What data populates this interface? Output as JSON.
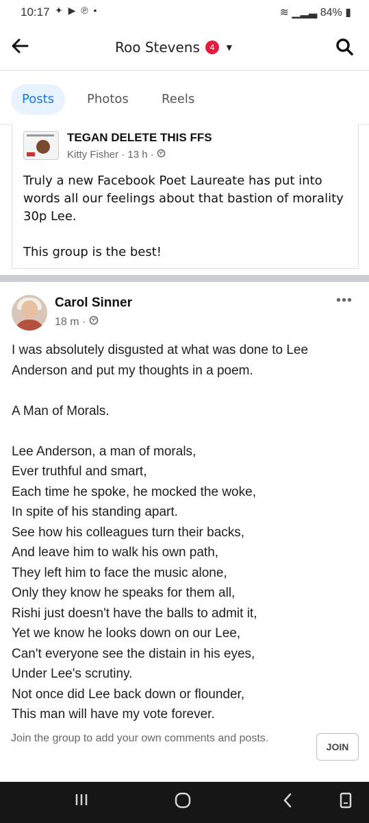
{
  "status_bar": {
    "time": "10:17",
    "left_icons": [
      "notification-icon",
      "youtube-icon",
      "pinterest-icon",
      "dot-icon"
    ],
    "battery": "84%"
  },
  "header": {
    "title": "Roo Stevens",
    "notification_count": "4",
    "icons": [
      "back-arrow-icon",
      "caret-down-icon",
      "search-icon"
    ]
  },
  "tabs": [
    {
      "label": "Posts",
      "active": true
    },
    {
      "label": "Photos",
      "active": false
    },
    {
      "label": "Reels",
      "active": false
    }
  ],
  "shared_post": {
    "group": "TEGAN DELETE THIS FFS",
    "author": "Kitty Fisher",
    "time": "13 h",
    "visibility_icon": "globe-icon",
    "paragraphs": [
      "Truly a new Facebook Poet Laureate has put into words all our feelings about that bastion of morality 30p Lee.",
      "This group is the best!"
    ]
  },
  "post": {
    "author": "Carol Sinner",
    "time": "18 m",
    "visibility_icon": "globe-icon",
    "intro": "I was absolutely disgusted at what was done to Lee Anderson and put my thoughts in a poem.",
    "poem_title": "A Man of Morals.",
    "poem_lines": [
      "Lee Anderson, a man of morals,",
      "Ever truthful and smart,",
      "Each time he spoke, he mocked the woke,",
      "In spite of his standing apart.",
      "See how his colleagues turn their backs,",
      "And leave him to walk his own path,",
      "They left him to face the music alone,",
      "Only they know he speaks for them all,",
      "Rishi just doesn't have the balls to admit it,",
      "Yet we know he looks down on our Lee,",
      "Can't everyone see the distain in his eyes,",
      "Under Lee's scrutiny.",
      "Not once did Lee back down or flounder,",
      "This man will have my vote forever."
    ]
  },
  "join_bar": {
    "text": "Join the group to add your own comments and posts.",
    "button": "JOIN"
  },
  "android_nav": [
    "recents-icon",
    "home-icon",
    "back-icon",
    "screenshot-icon"
  ],
  "colors": {
    "accent": "#1b74e4",
    "tab_active_bg": "#e7f3ff",
    "badge": "#e41e3f",
    "meta_text": "#65676b"
  }
}
